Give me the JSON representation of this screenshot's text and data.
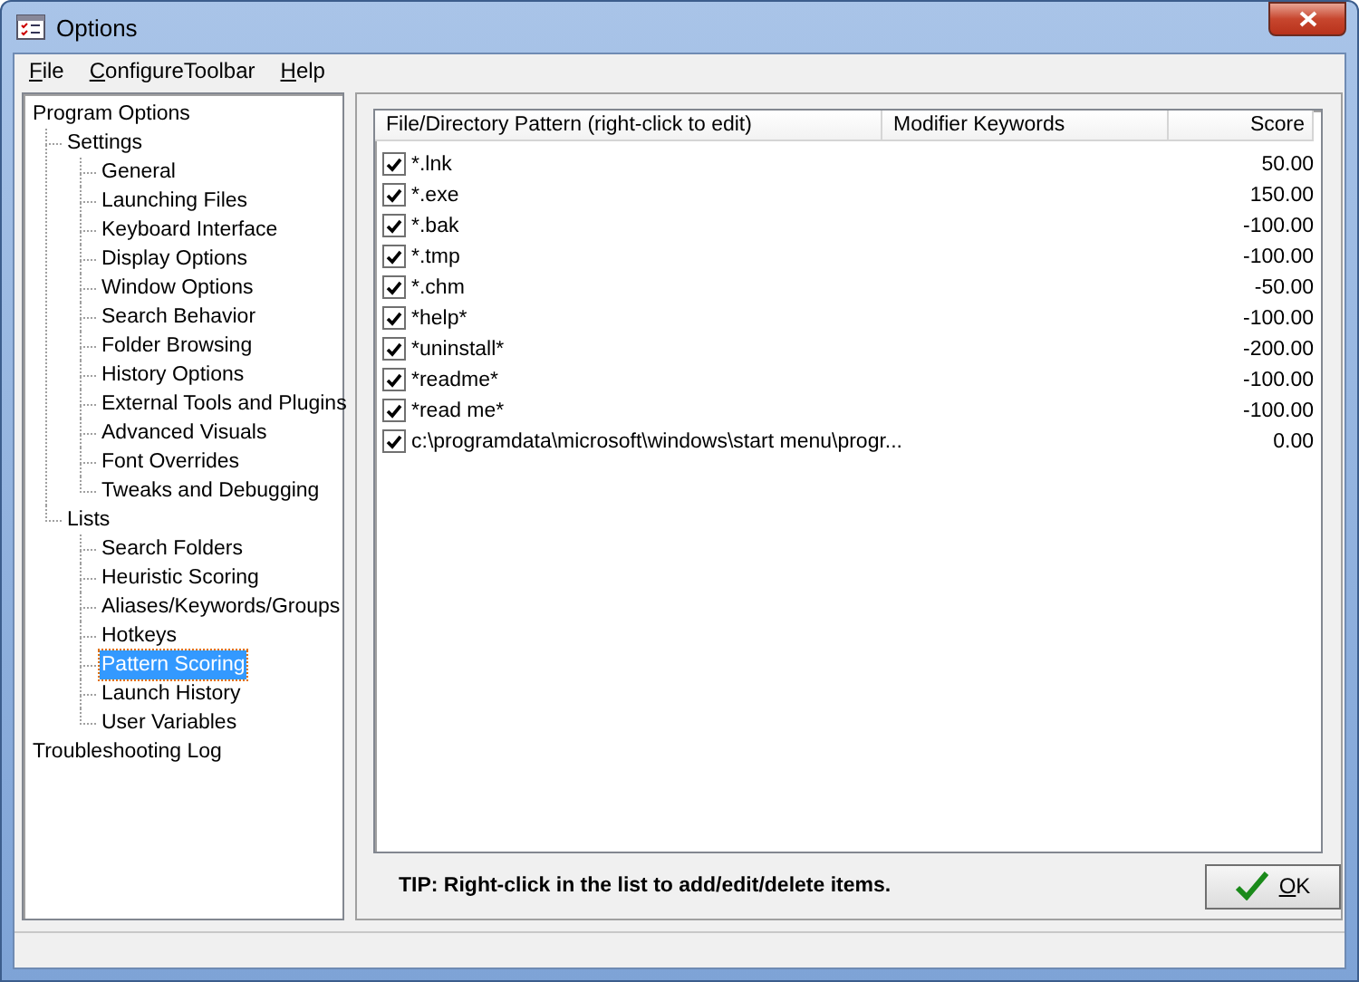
{
  "window": {
    "title": "Options"
  },
  "menu": [
    {
      "label": "File"
    },
    {
      "label": "ConfigureToolbar"
    },
    {
      "label": "Help"
    }
  ],
  "tree": [
    {
      "label": "Program Options",
      "selected": false,
      "children": [
        {
          "label": "Settings",
          "selected": false,
          "children": [
            {
              "label": "General",
              "selected": false
            },
            {
              "label": "Launching Files",
              "selected": false
            },
            {
              "label": "Keyboard Interface",
              "selected": false
            },
            {
              "label": "Display Options",
              "selected": false
            },
            {
              "label": "Window Options",
              "selected": false
            },
            {
              "label": "Search Behavior",
              "selected": false
            },
            {
              "label": "Folder Browsing",
              "selected": false
            },
            {
              "label": "History Options",
              "selected": false
            },
            {
              "label": "External Tools and Plugins",
              "selected": false
            },
            {
              "label": "Advanced Visuals",
              "selected": false
            },
            {
              "label": "Font Overrides",
              "selected": false
            },
            {
              "label": "Tweaks and Debugging",
              "selected": false
            }
          ]
        },
        {
          "label": "Lists",
          "selected": false,
          "children": [
            {
              "label": "Search Folders",
              "selected": false
            },
            {
              "label": "Heuristic Scoring",
              "selected": false
            },
            {
              "label": "Aliases/Keywords/Groups",
              "selected": false
            },
            {
              "label": "Hotkeys",
              "selected": false
            },
            {
              "label": "Pattern Scoring",
              "selected": true
            },
            {
              "label": "Launch History",
              "selected": false
            },
            {
              "label": "User Variables",
              "selected": false
            }
          ]
        }
      ]
    },
    {
      "label": "Troubleshooting Log",
      "selected": false
    }
  ],
  "table": {
    "columns": [
      "File/Directory Pattern (right-click to edit)",
      "Modifier Keywords",
      "Score"
    ],
    "rows": [
      {
        "pattern": "*.lnk",
        "checked": true,
        "score": "50.00"
      },
      {
        "pattern": "*.exe",
        "checked": true,
        "score": "150.00"
      },
      {
        "pattern": "*.bak",
        "checked": true,
        "score": "-100.00"
      },
      {
        "pattern": "*.tmp",
        "checked": true,
        "score": "-100.00"
      },
      {
        "pattern": "*.chm",
        "checked": true,
        "score": "-50.00"
      },
      {
        "pattern": "*help*",
        "checked": true,
        "score": "-100.00"
      },
      {
        "pattern": "*uninstall*",
        "checked": true,
        "score": "-200.00"
      },
      {
        "pattern": "*readme*",
        "checked": true,
        "score": "-100.00"
      },
      {
        "pattern": "*read me*",
        "checked": true,
        "score": "-100.00"
      },
      {
        "pattern": "c:\\programdata\\microsoft\\windows\\start menu\\progr...",
        "checked": true,
        "score": "0.00"
      }
    ]
  },
  "tip": "TIP: Right-click in the list to add/edit/delete items.",
  "ok_button": "OK"
}
